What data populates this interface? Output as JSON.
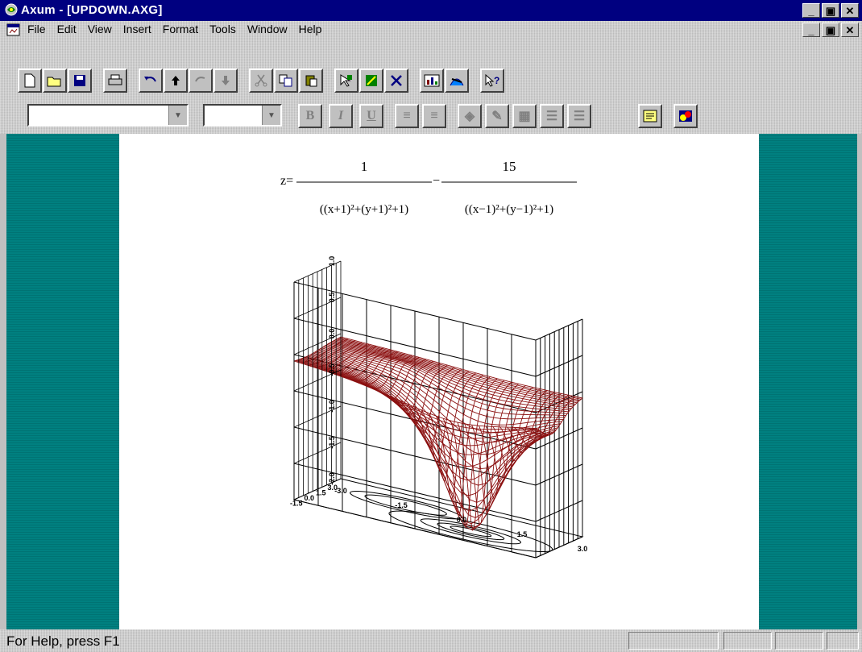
{
  "window": {
    "title": "Axum - [UPDOWN.AXG]",
    "minimize": "_",
    "maximize": "▣",
    "close": "✕"
  },
  "menu": {
    "items": [
      "File",
      "Edit",
      "View",
      "Insert",
      "Format",
      "Tools",
      "Window",
      "Help"
    ],
    "mdi_min": "_",
    "mdi_restore": "▣",
    "mdi_close": "✕"
  },
  "toolbar_standard": {
    "icons": [
      "new-icon",
      "open-icon",
      "save-icon",
      "print-icon",
      "undo-icon",
      "bring-forward-icon",
      "redo-icon",
      "send-backward-icon",
      "cut-icon",
      "copy-icon",
      "paste-icon",
      "select-tool-icon",
      "palette-icon",
      "delete-icon",
      "graph-gallery-icon",
      "graph-wizard-icon",
      "context-help-icon"
    ]
  },
  "toolbar_format": {
    "font_value": "",
    "size_value": "",
    "bold": "B",
    "italic": "I",
    "underline": "U"
  },
  "formula": {
    "lhs": "z=",
    "num1": "1",
    "num2": "15",
    "minus": "−",
    "den1": "((x+1)²+(y+1)²+1)",
    "den2": "((x−1)²+(y−1)²+1)"
  },
  "chart_data": {
    "type": "surface-3d",
    "function": "z = 1/((x+1)^2+(y+1)^2+1) - 15/((x-1)^2+(y-1)^2+1)",
    "x_range": [
      -3.0,
      3.0
    ],
    "y_range": [
      -3.0,
      3.0
    ],
    "z_range": [
      -2.0,
      1.0
    ],
    "z_ticks": [
      "1.0",
      "0.5",
      "0.0",
      "-0.5",
      "-1.0",
      "-1.5",
      "-2.0"
    ],
    "x_ticks": [
      "-3.0",
      "-1.5",
      "0.0",
      "1.5",
      "3.0"
    ],
    "y_ticks": [
      "-1.5",
      "0.0",
      "1.5",
      "3.0"
    ],
    "surface_color": "#8b1010",
    "contours_on_floor": true,
    "grid": true
  },
  "status": {
    "text": "For Help, press F1"
  },
  "colors": {
    "title_bar": "#000080",
    "workspace": "#008080",
    "surface": "#8b1010"
  }
}
